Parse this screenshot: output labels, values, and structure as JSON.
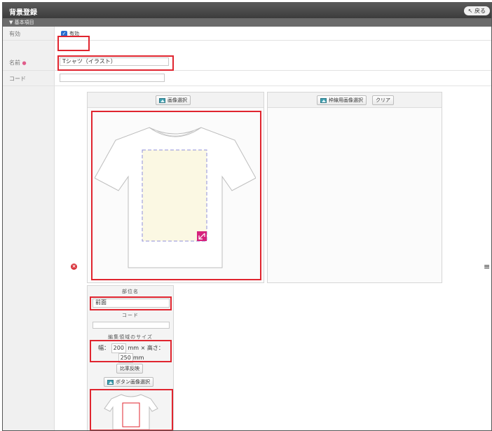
{
  "window": {
    "title": "背景登録",
    "back_label": "戻る"
  },
  "section": {
    "label": "▼ 基本項目"
  },
  "fields": {
    "enabled": {
      "label": "有効",
      "checkbox_label": "有効"
    },
    "name": {
      "label": "名前",
      "required_mark": "●",
      "value": "Tシャツ（イラスト）"
    },
    "code": {
      "label": "コード",
      "value": ""
    }
  },
  "image_panel": {
    "select_button": "画像選択"
  },
  "frame_panel": {
    "select_button": "枠線用画像選択",
    "clear_button": "クリア"
  },
  "edit_area": {
    "highlight_color": "#d6237d"
  },
  "part": {
    "name_label": "部位名",
    "name_value": "前面",
    "code_label": "コード",
    "code_value": "",
    "size_label": "編集領域のサイズ",
    "width_label": "幅：",
    "width_value": "200",
    "unit": "mm",
    "times": "×",
    "height_label": "高さ：",
    "height_value": "250",
    "ratio_button": "比率反映",
    "button_image_select": "ボタン画像選択"
  },
  "icons": {
    "error": "x-circle-icon",
    "menu": "hamburger-icon",
    "image": "image-icon"
  },
  "colors": {
    "title_bar": "#444444",
    "highlight_red": "#e0252f",
    "checkbox": "#2a6fd1"
  }
}
